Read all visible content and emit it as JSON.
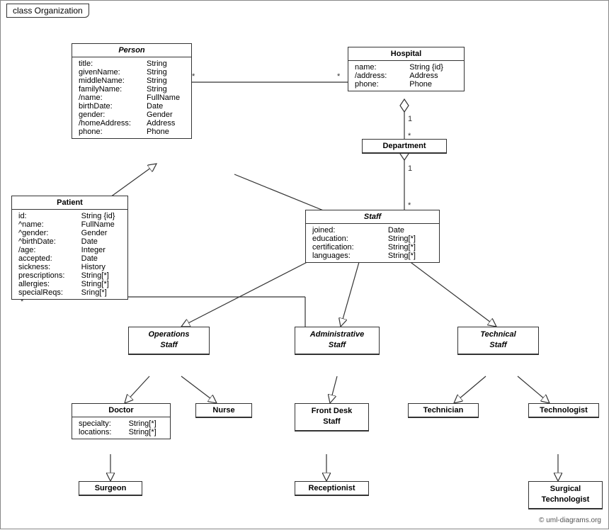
{
  "title": "class Organization",
  "copyright": "© uml-diagrams.org",
  "boxes": {
    "person": {
      "title": "Person",
      "italic": true,
      "attrs": [
        [
          "title:",
          "String"
        ],
        [
          "givenName:",
          "String"
        ],
        [
          "middleName:",
          "String"
        ],
        [
          "familyName:",
          "String"
        ],
        [
          "/name:",
          "FullName"
        ],
        [
          "birthDate:",
          "Date"
        ],
        [
          "gender:",
          "Gender"
        ],
        [
          "/homeAddress:",
          "Address"
        ],
        [
          "phone:",
          "Phone"
        ]
      ]
    },
    "hospital": {
      "title": "Hospital",
      "italic": false,
      "attrs": [
        [
          "name:",
          "String {id}"
        ],
        [
          "/address:",
          "Address"
        ],
        [
          "phone:",
          "Phone"
        ]
      ]
    },
    "patient": {
      "title": "Patient",
      "italic": false,
      "attrs": [
        [
          "id:",
          "String {id}"
        ],
        [
          "^name:",
          "FullName"
        ],
        [
          "^gender:",
          "Gender"
        ],
        [
          "^birthDate:",
          "Date"
        ],
        [
          "/age:",
          "Integer"
        ],
        [
          "accepted:",
          "Date"
        ],
        [
          "sickness:",
          "History"
        ],
        [
          "prescriptions:",
          "String[*]"
        ],
        [
          "allergies:",
          "String[*]"
        ],
        [
          "specialReqs:",
          "Sring[*]"
        ]
      ]
    },
    "department": {
      "title": "Department",
      "italic": false,
      "attrs": []
    },
    "staff": {
      "title": "Staff",
      "italic": true,
      "attrs": [
        [
          "joined:",
          "Date"
        ],
        [
          "education:",
          "String[*]"
        ],
        [
          "certification:",
          "String[*]"
        ],
        [
          "languages:",
          "String[*]"
        ]
      ]
    },
    "operations_staff": {
      "title": "Operations\nStaff",
      "italic": true,
      "attrs": []
    },
    "administrative_staff": {
      "title": "Administrative\nStaff",
      "italic": true,
      "attrs": []
    },
    "technical_staff": {
      "title": "Technical\nStaff",
      "italic": true,
      "attrs": []
    },
    "doctor": {
      "title": "Doctor",
      "italic": false,
      "attrs": [
        [
          "specialty:",
          "String[*]"
        ],
        [
          "locations:",
          "String[*]"
        ]
      ]
    },
    "nurse": {
      "title": "Nurse",
      "italic": false,
      "attrs": []
    },
    "front_desk_staff": {
      "title": "Front Desk\nStaff",
      "italic": false,
      "attrs": []
    },
    "technician": {
      "title": "Technician",
      "italic": false,
      "attrs": []
    },
    "technologist": {
      "title": "Technologist",
      "italic": false,
      "attrs": []
    },
    "surgeon": {
      "title": "Surgeon",
      "italic": false,
      "attrs": []
    },
    "receptionist": {
      "title": "Receptionist",
      "italic": false,
      "attrs": []
    },
    "surgical_technologist": {
      "title": "Surgical\nTechnologist",
      "italic": false,
      "attrs": []
    }
  }
}
